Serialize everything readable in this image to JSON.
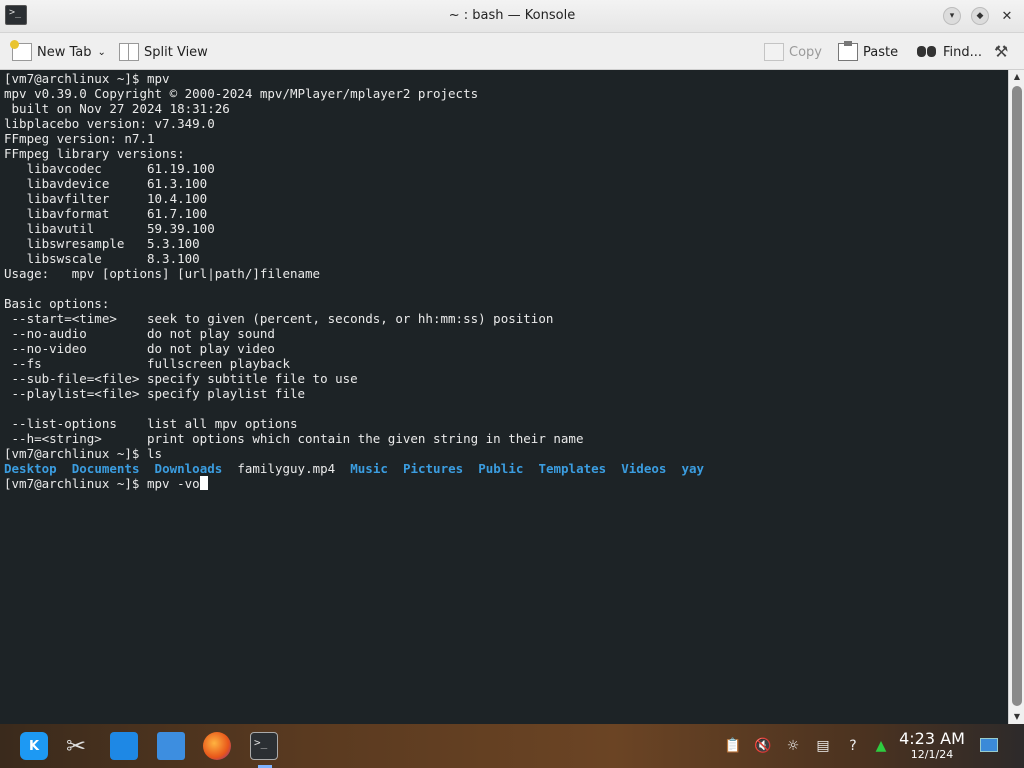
{
  "window": {
    "title": "~ : bash — Konsole",
    "app_icon_glyph": ">_"
  },
  "toolbar": {
    "new_tab": "New Tab",
    "split_view": "Split View",
    "copy": "Copy",
    "paste": "Paste",
    "find": "Find..."
  },
  "terminal": {
    "lines": [
      "[vm7@archlinux ~]$ mpv",
      "mpv v0.39.0 Copyright © 2000-2024 mpv/MPlayer/mplayer2 projects",
      " built on Nov 27 2024 18:31:26",
      "libplacebo version: v7.349.0",
      "FFmpeg version: n7.1",
      "FFmpeg library versions:",
      "   libavcodec      61.19.100",
      "   libavdevice     61.3.100",
      "   libavfilter     10.4.100",
      "   libavformat     61.7.100",
      "   libavutil       59.39.100",
      "   libswresample   5.3.100",
      "   libswscale      8.3.100",
      "Usage:   mpv [options] [url|path/]filename",
      "",
      "Basic options:",
      " --start=<time>    seek to given (percent, seconds, or hh:mm:ss) position",
      " --no-audio        do not play sound",
      " --no-video        do not play video",
      " --fs              fullscreen playback",
      " --sub-file=<file> specify subtitle file to use",
      " --playlist=<file> specify playlist file",
      "",
      " --list-options    list all mpv options",
      " --h=<string>      print options which contain the given string in their name",
      "[vm7@archlinux ~]$ ls"
    ],
    "ls_output": {
      "desktop": "Desktop",
      "documents": "Documents",
      "downloads": "Downloads",
      "familyguy": "familyguy.mp4",
      "music": "Music",
      "pictures": "Pictures",
      "public": "Public",
      "templates": "Templates",
      "videos": "Videos",
      "yay": "yay"
    },
    "current_prompt": "[vm7@archlinux ~]$ mpv -vo"
  },
  "colors": {
    "terminal_bg": "#1d2326",
    "terminal_fg": "#eaeaea",
    "directory": "#3b9de0"
  },
  "taskbar": {
    "kde_label": "K",
    "konsole_glyph": ">_",
    "time": "4:23 AM",
    "date": "12/1/24"
  }
}
